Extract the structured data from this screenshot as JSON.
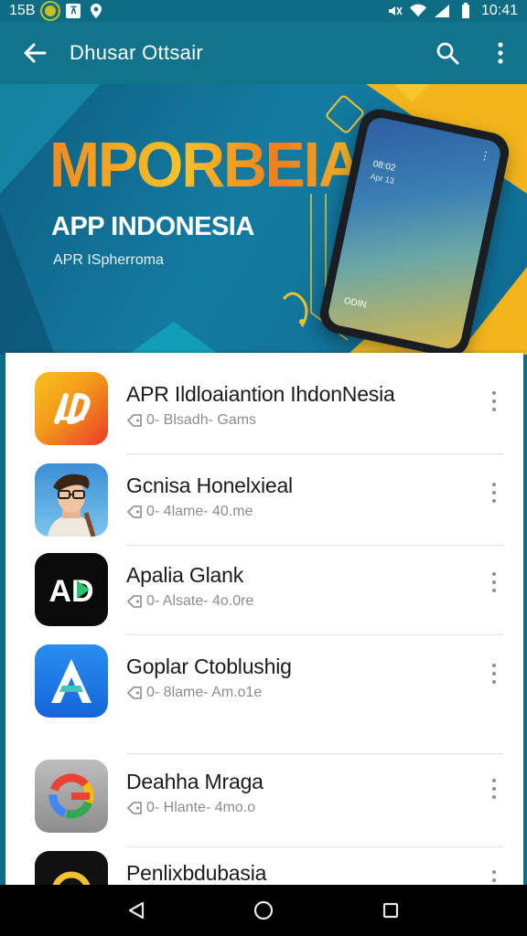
{
  "status_bar": {
    "time_left": "15B",
    "time_right": "10:41"
  },
  "app_bar": {
    "title": "Dhusar Ottsair"
  },
  "banner": {
    "headline": "MPORBEIA!",
    "subtitle": "APP INDONESIA",
    "caption": "APR ISpherroma",
    "phone_text_1": "08:02",
    "phone_text_2": "Apr 13",
    "phone_text_3": "ODIN"
  },
  "apps": [
    {
      "name": "APR Ildloaiantion IhdonNesia",
      "meta": "0- Blsadh- Gams"
    },
    {
      "name": "Gcnisa Honelxieal",
      "meta": "0- 4lame- 40.me"
    },
    {
      "name": "Apalia Glank",
      "meta": "0- Alsate- 4o.0re"
    },
    {
      "name": "Goplar Ctoblushig",
      "meta": "0- 8lame- Am.o1e"
    },
    {
      "name": "Deahha Mraga",
      "meta": "0- Hlante- 4mo.o"
    },
    {
      "name": "Penlixbdubasia",
      "meta": ""
    }
  ],
  "app_icon_text": {
    "ad": "AD",
    "a": "A"
  },
  "colors": {
    "accent": "#11748b",
    "banner_orange": "#f28a1c",
    "banner_yellow": "#f6c22a"
  }
}
